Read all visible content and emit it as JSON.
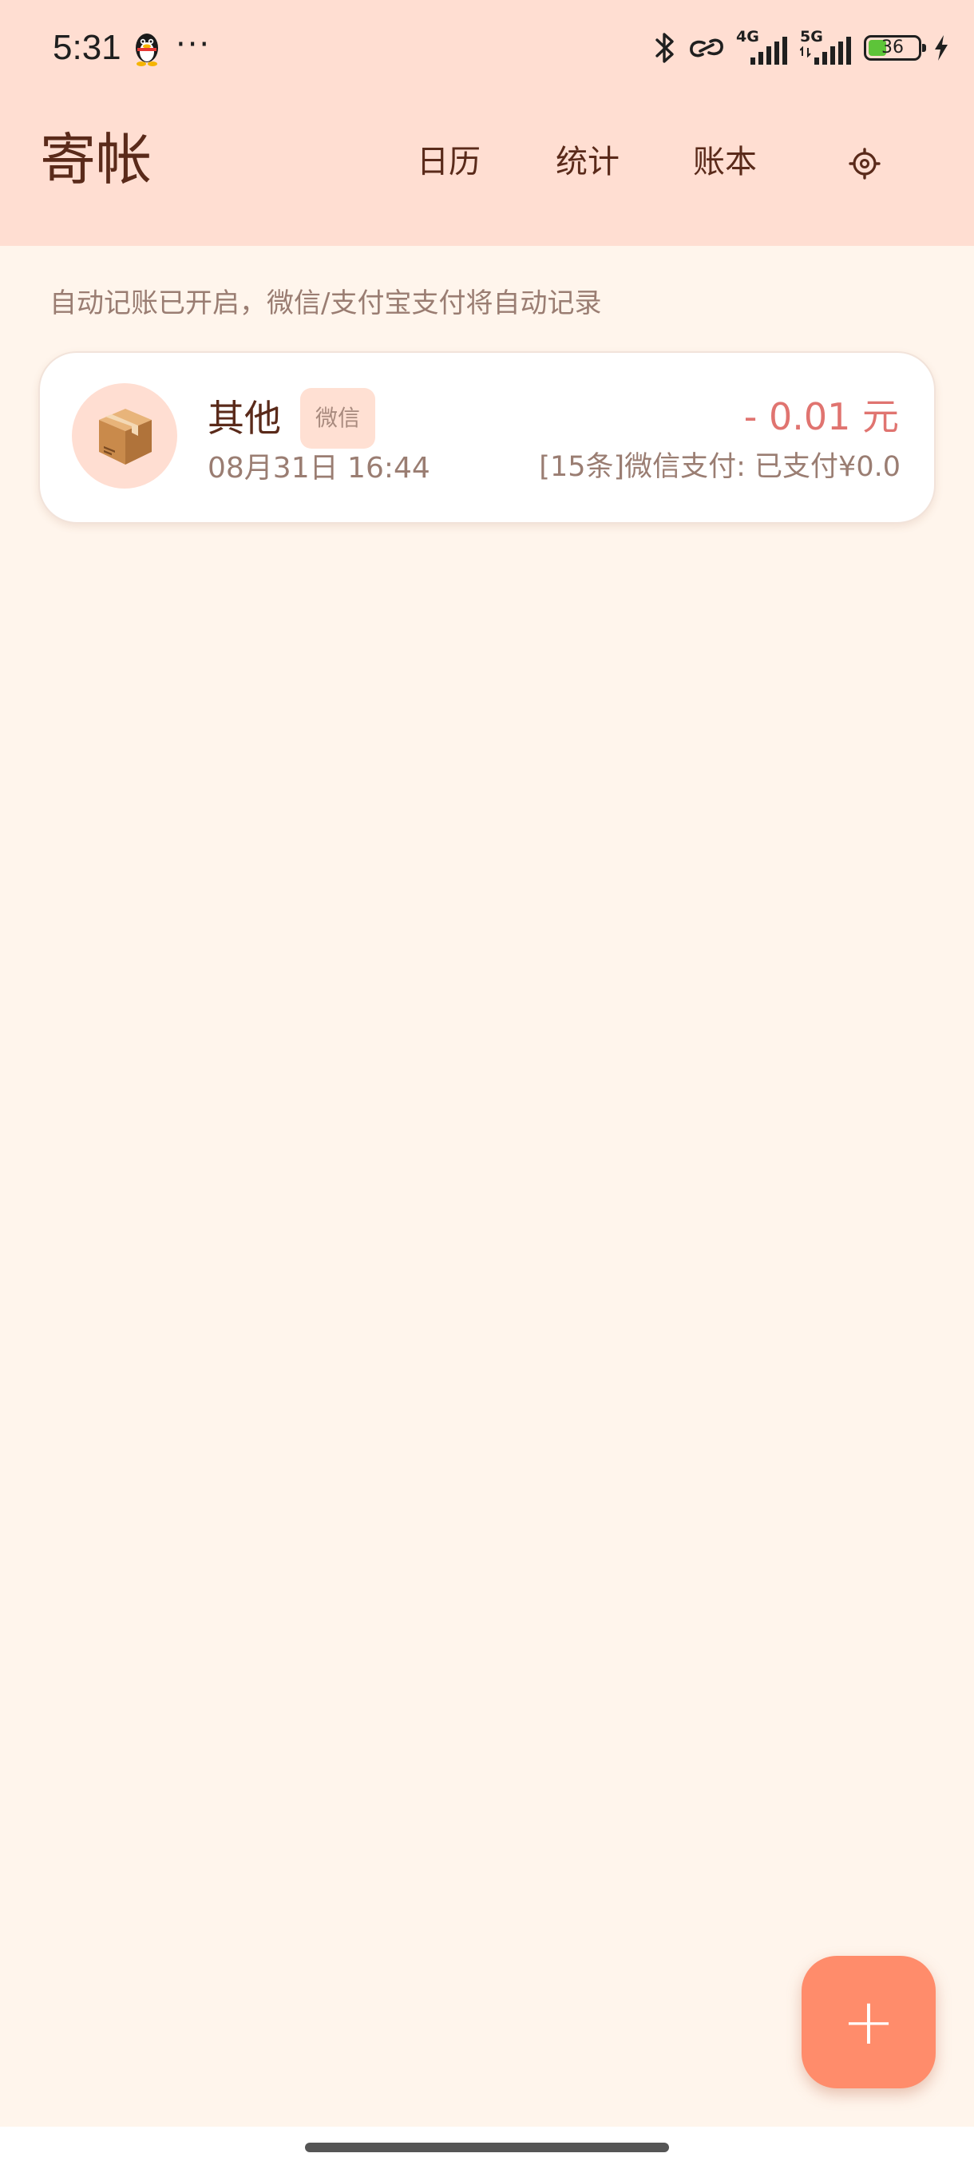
{
  "status_bar": {
    "time": "5:31",
    "dots": "···",
    "network_4g": "4G",
    "network_5g": "5G",
    "battery_level": "36",
    "battery_fraction": 0.36,
    "icons": [
      "qq-penguin-icon",
      "bluetooth-icon",
      "hotspot-link-icon",
      "signal-4g-icon",
      "signal-5g-icon",
      "battery-icon",
      "charging-bolt-icon"
    ]
  },
  "header": {
    "title": "寄帐",
    "nav": {
      "calendar": "日历",
      "stats": "统计",
      "books": "账本"
    },
    "settings_icon": "gear-icon"
  },
  "notice": "自动记账已开启，微信/支付宝支付将自动记录",
  "records": [
    {
      "category": "其他",
      "category_icon": "package-box-icon",
      "tag": "微信",
      "datetime": "08月31日 16:44",
      "amount": "- 0.01 元",
      "note": "[15条]微信支付: 已支付¥0.0"
    }
  ],
  "fab": {
    "label": "+"
  },
  "colors": {
    "header_bg": "#FFDED2",
    "page_bg": "#FFF5EC",
    "accent": "#FF8C6B",
    "expense": "#E07470",
    "text_primary": "#5A2A1A",
    "text_secondary": "#9A7D72"
  }
}
